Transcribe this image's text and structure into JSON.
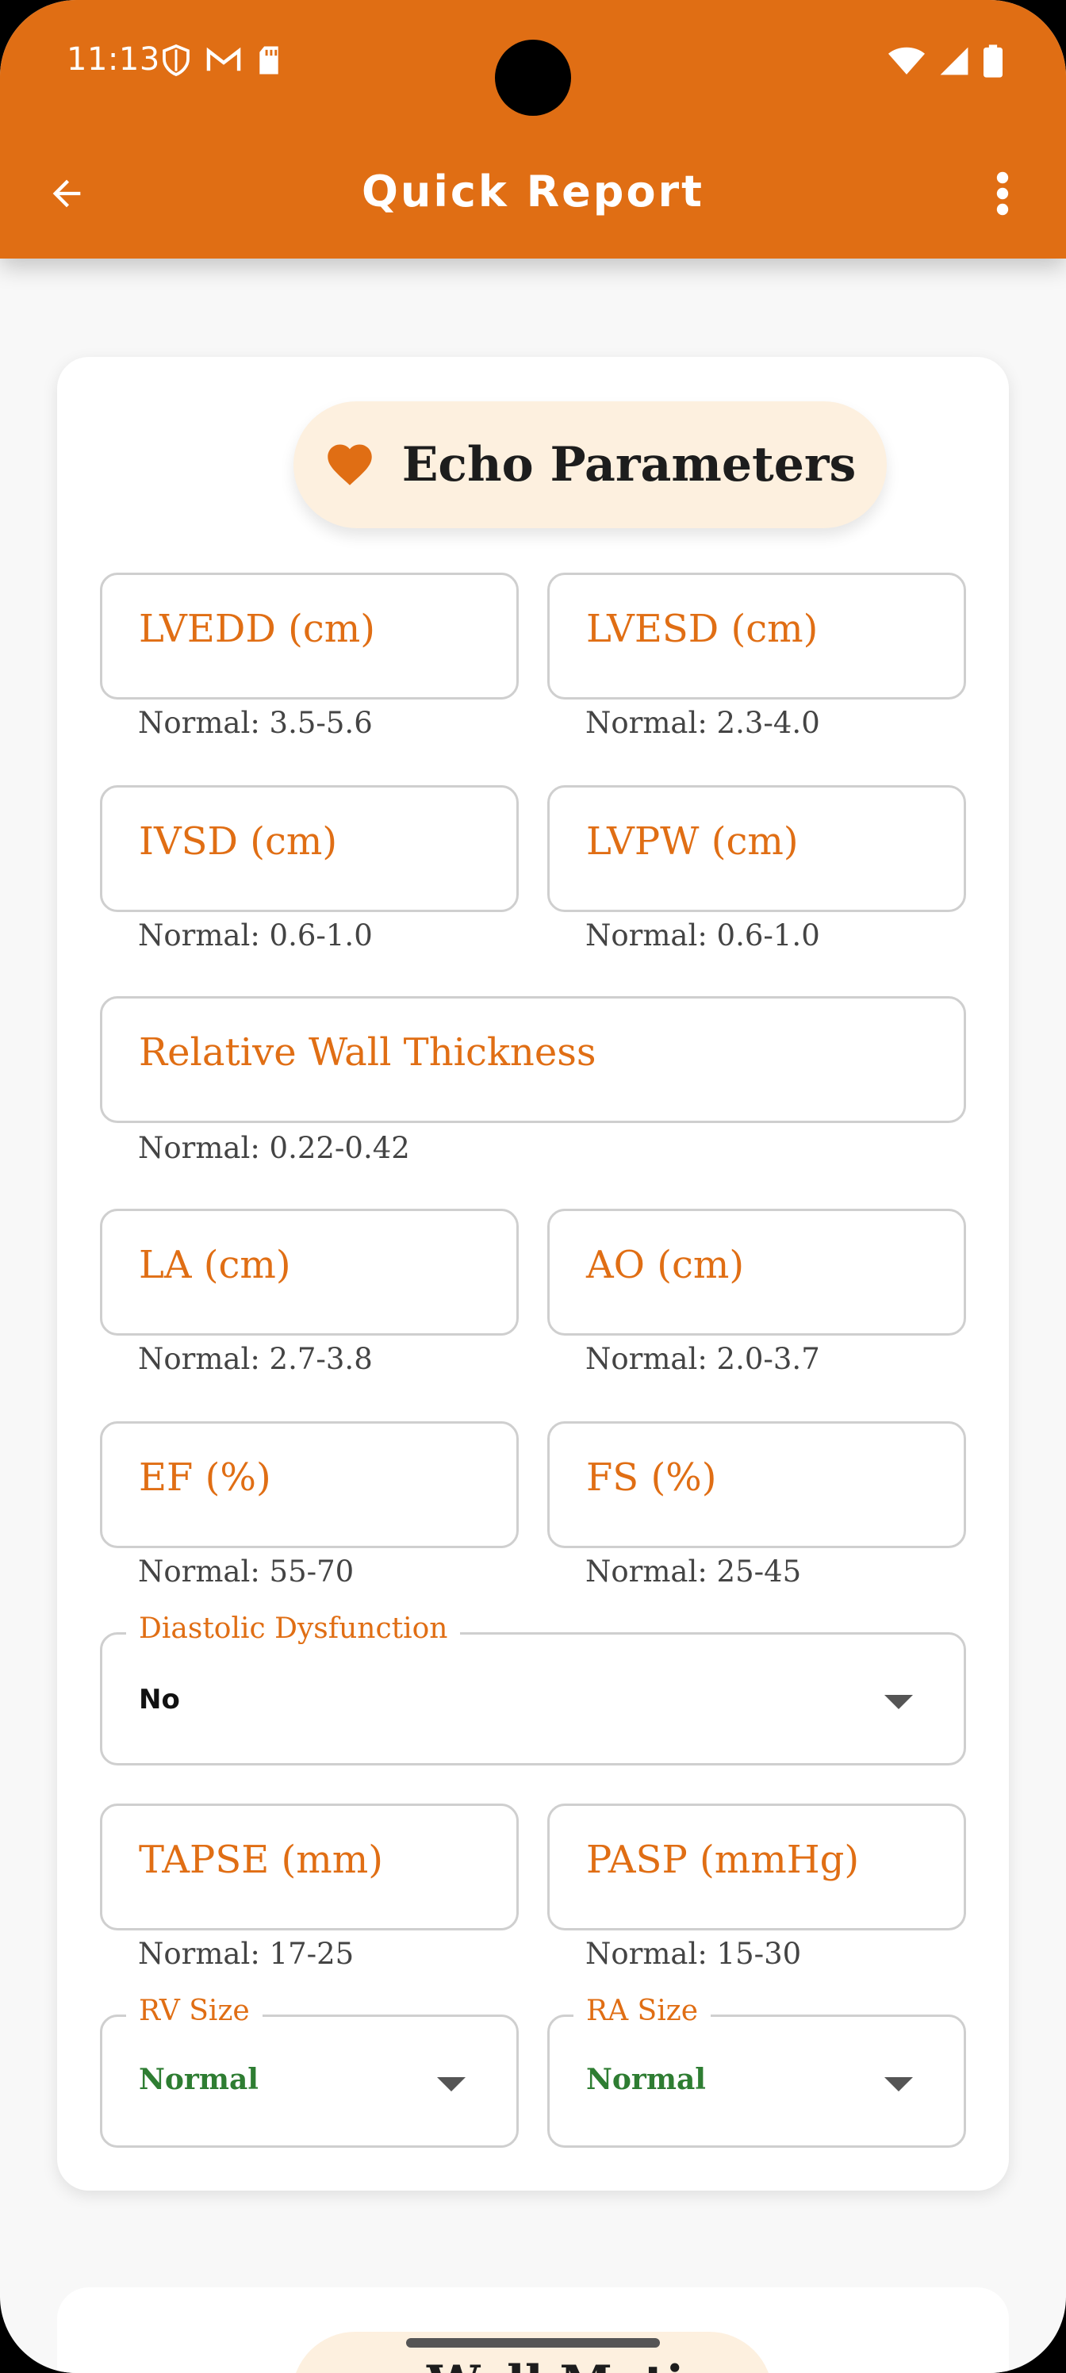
{
  "status_bar": {
    "time": "11:13"
  },
  "app_bar": {
    "title": "Quick Report",
    "back_icon": "arrow-left-icon",
    "menu_icon": "more-vert-icon"
  },
  "section": {
    "title": "Echo Parameters",
    "icon": "heart-icon"
  },
  "fields": {
    "lvedd": {
      "label": "LVEDD (cm)",
      "hint": "Normal: 3.5-5.6"
    },
    "lvesd": {
      "label": "LVESD (cm)",
      "hint": "Normal: 2.3-4.0"
    },
    "ivsd": {
      "label": "IVSD (cm)",
      "hint": "Normal: 0.6-1.0"
    },
    "lvpw": {
      "label": "LVPW (cm)",
      "hint": "Normal: 0.6-1.0"
    },
    "rwt": {
      "label": "Relative Wall Thickness",
      "hint": "Normal: 0.22-0.42"
    },
    "la": {
      "label": "LA (cm)",
      "hint": "Normal: 2.7-3.8"
    },
    "ao": {
      "label": "AO (cm)",
      "hint": "Normal: 2.0-3.7"
    },
    "ef": {
      "label": "EF (%)",
      "hint": "Normal: 55-70"
    },
    "fs": {
      "label": "FS (%)",
      "hint": "Normal: 25-45"
    },
    "tapse": {
      "label": "TAPSE (mm)",
      "hint": "Normal: 17-25"
    },
    "pasp": {
      "label": "PASP (mmHg)",
      "hint": "Normal: 15-30"
    }
  },
  "dropdowns": {
    "diastolic": {
      "label": "Diastolic Dysfunction",
      "value": "No"
    },
    "rv_size": {
      "label": "RV Size",
      "value": "Normal"
    },
    "ra_size": {
      "label": "RA Size",
      "value": "Normal"
    }
  },
  "next_section": {
    "title": "Wall Motion"
  },
  "colors": {
    "primary": "#e06e14",
    "pill_bg": "#fdf0df",
    "normal_green": "#2e7d32"
  }
}
